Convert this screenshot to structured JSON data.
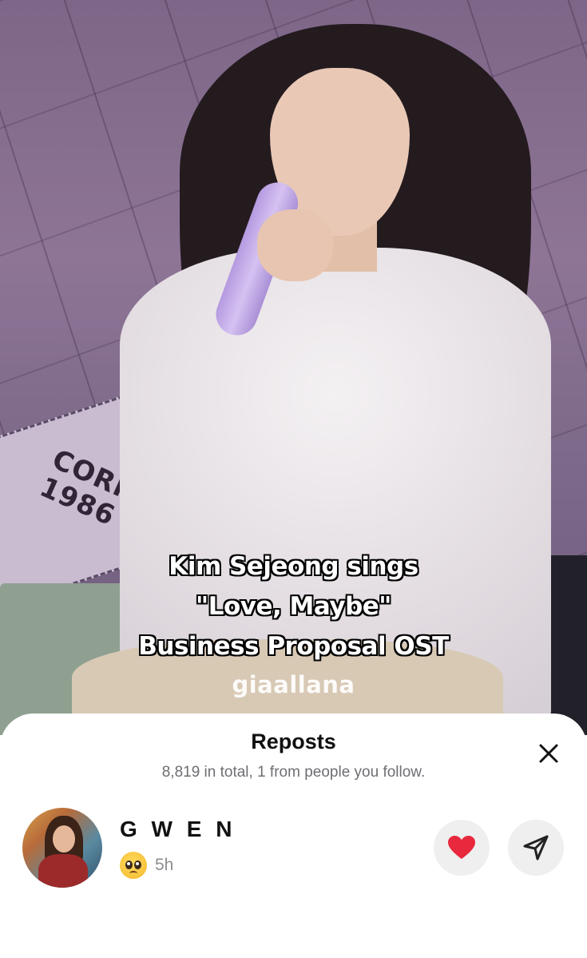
{
  "video": {
    "caption_lines": [
      "Kim Sejeong sings",
      "\"Love, Maybe\"",
      "Business Proposal OST"
    ],
    "watermark": "giaallana",
    "background_sign": [
      "CORR",
      "1986"
    ]
  },
  "sheet": {
    "title": "Reposts",
    "subtitle": "8,819 in total, 1 from people you follow.",
    "close_icon": "close-icon"
  },
  "reposter": {
    "username": "G W E N",
    "reaction_emoji": "pleading-face-emoji",
    "time": "5h",
    "liked": true
  },
  "colors": {
    "heart": "#e8283c",
    "action_bg": "#efefef",
    "subtitle_gray": "#6e6e73",
    "time_gray": "#8e8e93",
    "mic": "#c3aaeb"
  }
}
